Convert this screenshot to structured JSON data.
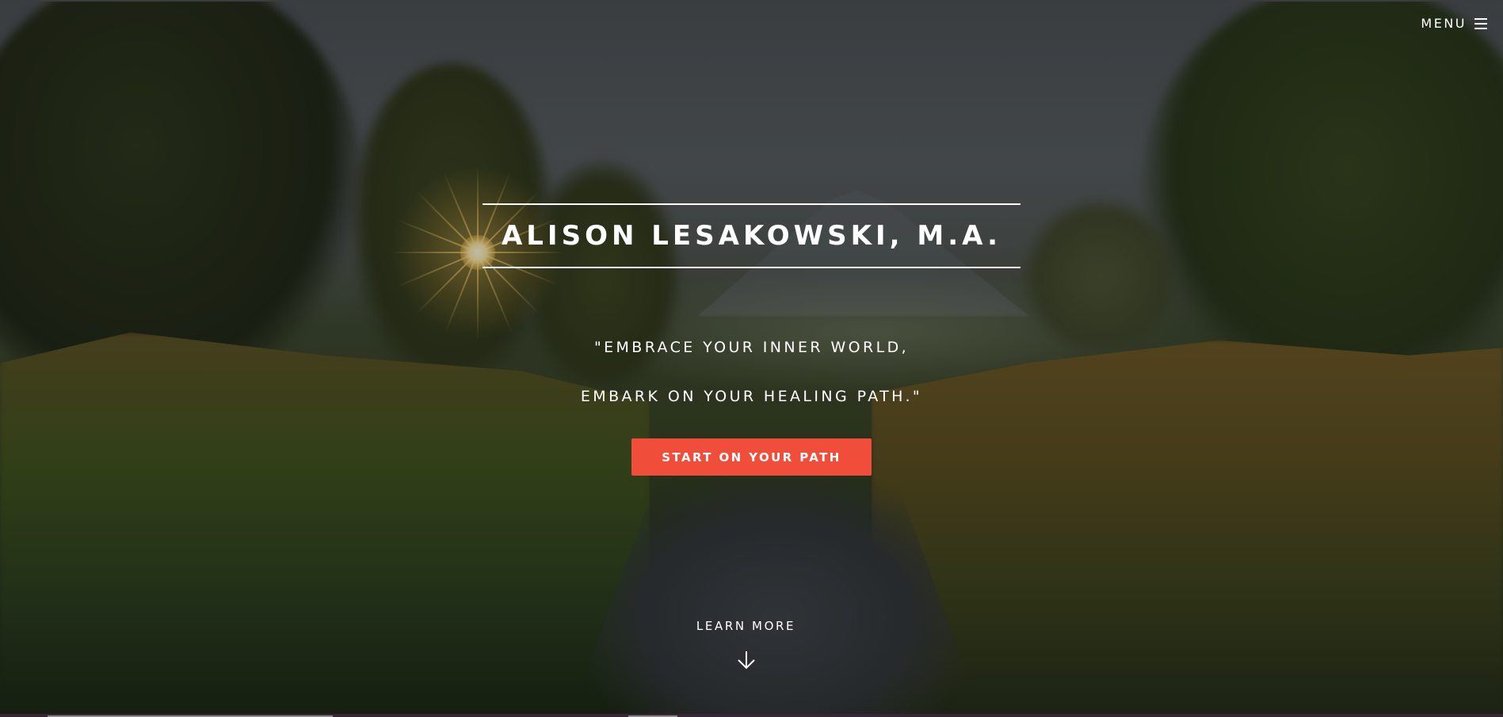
{
  "header": {
    "menu_label": "MENU",
    "menu_icon": "hamburger-icon"
  },
  "hero": {
    "title": "ALISON LESAKOWSKI, M.A.",
    "quote_line_1": "\"EMBRACE YOUR INNER WORLD,",
    "quote_line_2": "EMBARK ON YOUR HEALING PATH.\"",
    "cta_label": "START ON YOUR PATH",
    "learn_more_label": "LEARN MORE",
    "learn_more_icon": "arrow-down-icon"
  },
  "colors": {
    "accent": "#f04e3b",
    "text": "#ffffff"
  }
}
